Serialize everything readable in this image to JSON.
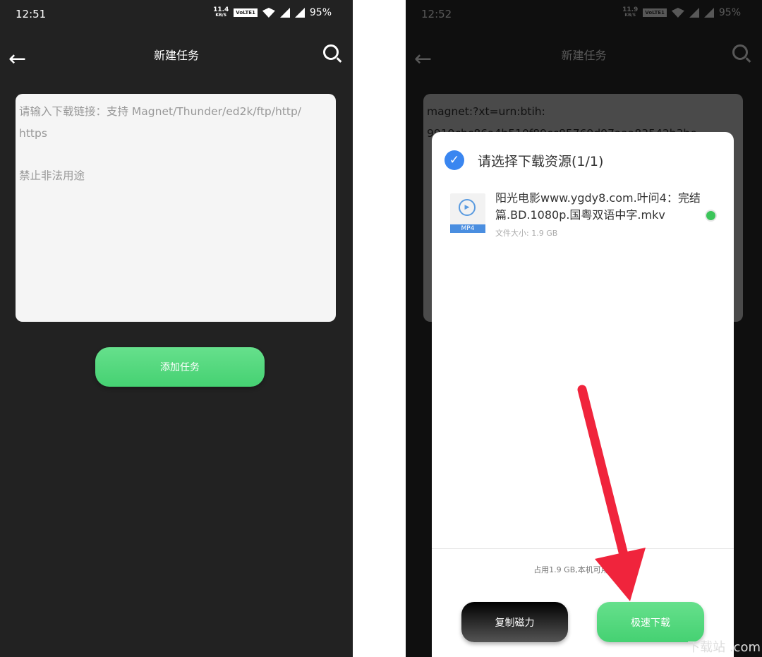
{
  "left": {
    "status": {
      "time": "12:51",
      "speed": "11.4",
      "speed_unit": "KB/S",
      "volte": "VoLTE1",
      "battery": "95%"
    },
    "header": {
      "title": "新建任务"
    },
    "input": {
      "placeholder_line1": "请输入下载链接：支持 Magnet/Thunder/ed2k/ftp/http/",
      "placeholder_line2": "https",
      "placeholder_line3": "禁止非法用途"
    },
    "add_button": "添加任务"
  },
  "right": {
    "status": {
      "time": "12:52",
      "speed": "11.9",
      "speed_unit": "KB/S",
      "volte": "VoLTE1",
      "battery": "95%"
    },
    "header": {
      "title": "新建任务"
    },
    "input": {
      "line1": "magnet:?xt=urn:btih:",
      "line2": "9919cbc86a4b510f89cc85769d97aaa83542b3be"
    },
    "dialog": {
      "title": "请选择下载资源(1/1)",
      "file_type": "MP4",
      "file_name": "阳光电影www.ygdy8.com.叶问4：完结篇.BD.1080p.国粤双语中字.mkv",
      "file_size": "文件大小: 1.9 GB",
      "space_info": "占用1.9 GB,本机可用空间        B",
      "copy_button": "复制磁力",
      "download_button": "极速下载"
    },
    "watermark": "下载站 .com"
  },
  "colors": {
    "accent_green": "#4fd67a",
    "check_blue": "#3a86f0",
    "arrow_red": "#f0243c"
  }
}
